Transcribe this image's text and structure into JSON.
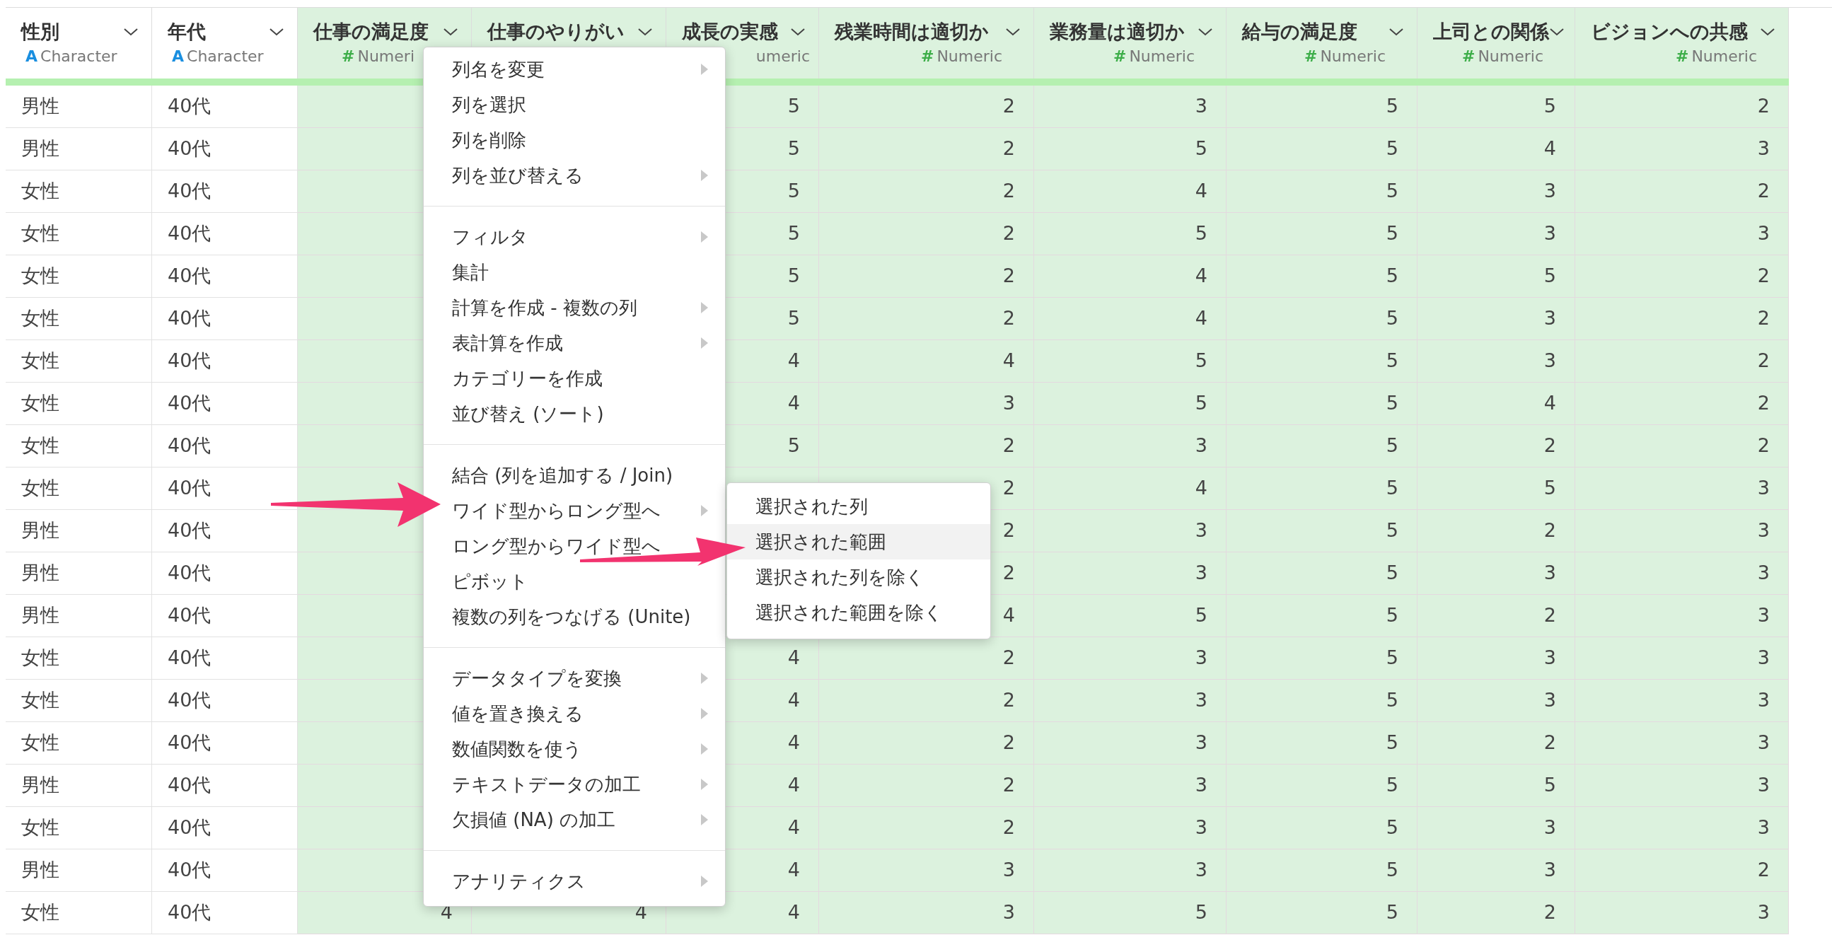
{
  "columns": [
    {
      "name": "性別",
      "type_icon": "A",
      "type": "Character",
      "kind": "character"
    },
    {
      "name": "年代",
      "type_icon": "A",
      "type": "Character",
      "kind": "character"
    },
    {
      "name": "仕事の満足度",
      "type_icon": "#",
      "type": "Numeri",
      "kind": "numeric"
    },
    {
      "name": "仕事のやりがい",
      "kind": "numeric"
    },
    {
      "name": "成長の実感",
      "type": "umeric",
      "kind": "numeric"
    },
    {
      "name": "残業時間は適切か",
      "type_icon": "#",
      "type": "Numeric",
      "kind": "numeric"
    },
    {
      "name": "業務量は適切か",
      "type_icon": "#",
      "type": "Numeric",
      "kind": "numeric"
    },
    {
      "name": "給与の満足度",
      "type_icon": "#",
      "type": "Numeric",
      "kind": "numeric"
    },
    {
      "name": "上司との関係",
      "type_icon": "#",
      "type": "Numeric",
      "kind": "numeric"
    },
    {
      "name": "ビジョンへの共感",
      "type_icon": "#",
      "type": "Numeric",
      "kind": "numeric"
    }
  ],
  "rows": [
    [
      "男性",
      "40代",
      null,
      null,
      "5",
      "2",
      "3",
      "5",
      "5",
      "2"
    ],
    [
      "男性",
      "40代",
      null,
      null,
      "5",
      "2",
      "5",
      "5",
      "4",
      "3"
    ],
    [
      "女性",
      "40代",
      null,
      null,
      "5",
      "2",
      "4",
      "5",
      "3",
      "2"
    ],
    [
      "女性",
      "40代",
      null,
      null,
      "5",
      "2",
      "5",
      "5",
      "3",
      "3"
    ],
    [
      "女性",
      "40代",
      null,
      null,
      "5",
      "2",
      "4",
      "5",
      "5",
      "2"
    ],
    [
      "女性",
      "40代",
      null,
      null,
      "5",
      "2",
      "4",
      "5",
      "3",
      "2"
    ],
    [
      "女性",
      "40代",
      null,
      null,
      "4",
      "4",
      "5",
      "5",
      "3",
      "2"
    ],
    [
      "女性",
      "40代",
      null,
      null,
      "4",
      "3",
      "5",
      "5",
      "4",
      "2"
    ],
    [
      "女性",
      "40代",
      null,
      null,
      "5",
      "2",
      "3",
      "5",
      "2",
      "2"
    ],
    [
      "女性",
      "40代",
      null,
      null,
      null,
      "2",
      "4",
      "5",
      "5",
      "3"
    ],
    [
      "男性",
      "40代",
      null,
      null,
      null,
      "2",
      "3",
      "5",
      "2",
      "3"
    ],
    [
      "男性",
      "40代",
      null,
      null,
      null,
      "2",
      "3",
      "5",
      "3",
      "3"
    ],
    [
      "男性",
      "40代",
      null,
      null,
      null,
      "4",
      "5",
      "5",
      "2",
      "3"
    ],
    [
      "女性",
      "40代",
      null,
      null,
      "4",
      "2",
      "3",
      "5",
      "3",
      "3"
    ],
    [
      "女性",
      "40代",
      null,
      null,
      "4",
      "2",
      "3",
      "5",
      "3",
      "3"
    ],
    [
      "女性",
      "40代",
      null,
      null,
      "4",
      "2",
      "3",
      "5",
      "2",
      "3"
    ],
    [
      "男性",
      "40代",
      null,
      null,
      "4",
      "2",
      "3",
      "5",
      "5",
      "3"
    ],
    [
      "女性",
      "40代",
      null,
      null,
      "4",
      "2",
      "3",
      "5",
      "3",
      "3"
    ],
    [
      "男性",
      "40代",
      null,
      null,
      "4",
      "3",
      "3",
      "5",
      "3",
      "2"
    ],
    [
      "女性",
      "40代",
      "4",
      "4",
      "4",
      "3",
      "5",
      "5",
      "2",
      "3"
    ]
  ],
  "context_menu": {
    "groups": [
      [
        {
          "label": "列名を変更",
          "submenu": true
        },
        {
          "label": "列を選択",
          "submenu": false
        },
        {
          "label": "列を削除",
          "submenu": false
        },
        {
          "label": "列を並び替える",
          "submenu": true
        }
      ],
      [
        {
          "label": "フィルタ",
          "submenu": true
        },
        {
          "label": "集計",
          "submenu": false
        },
        {
          "label": "計算を作成 - 複数の列",
          "submenu": true
        },
        {
          "label": "表計算を作成",
          "submenu": true
        },
        {
          "label": "カテゴリーを作成",
          "submenu": false
        },
        {
          "label": "並び替え (ソート)",
          "submenu": false
        }
      ],
      [
        {
          "label": "結合 (列を追加する / Join)",
          "submenu": false
        },
        {
          "label": "ワイド型からロング型へ",
          "submenu": true
        },
        {
          "label": "ロング型からワイド型へ"
        },
        {
          "label": "ピボット",
          "submenu": false
        },
        {
          "label": "複数の列をつなげる (Unite)",
          "submenu": false
        }
      ],
      [
        {
          "label": "データタイプを変換",
          "submenu": true
        },
        {
          "label": "値を置き換える",
          "submenu": true
        },
        {
          "label": "数値関数を使う",
          "submenu": true
        },
        {
          "label": "テキストデータの加工",
          "submenu": true
        },
        {
          "label": "欠損値 (NA) の加工",
          "submenu": true
        }
      ],
      [
        {
          "label": "アナリティクス",
          "submenu": true
        }
      ]
    ]
  },
  "submenu": [
    {
      "label": "選択された列",
      "selected": false
    },
    {
      "label": "選択された範囲",
      "selected": true
    },
    {
      "label": "選択された列を除く",
      "selected": false
    },
    {
      "label": "選択された範囲を除く",
      "selected": false
    }
  ]
}
